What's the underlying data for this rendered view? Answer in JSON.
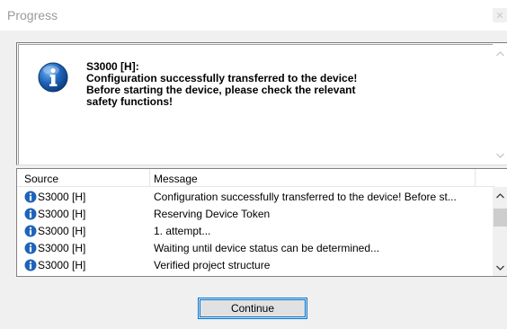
{
  "window": {
    "title": "Progress"
  },
  "message_box": {
    "icon": "info-icon",
    "lines": [
      "S3000 [H]:",
      "Configuration successfully transferred to the device!",
      "Before starting the device, please check the relevant",
      "safety functions!"
    ]
  },
  "log": {
    "columns": [
      "Source",
      "Message"
    ],
    "rows": [
      {
        "source": "S3000 [H]",
        "message": "Configuration successfully transferred to the device!  Before st..."
      },
      {
        "source": "S3000 [H]",
        "message": "Reserving Device Token"
      },
      {
        "source": "S3000 [H]",
        "message": "1. attempt..."
      },
      {
        "source": "S3000 [H]",
        "message": "Waiting until device status can be determined..."
      },
      {
        "source": "S3000 [H]",
        "message": "Verified project structure"
      }
    ]
  },
  "buttons": {
    "continue": "Continue"
  },
  "colors": {
    "info_blue": "#1e63b8",
    "accent": "#0078d7"
  }
}
